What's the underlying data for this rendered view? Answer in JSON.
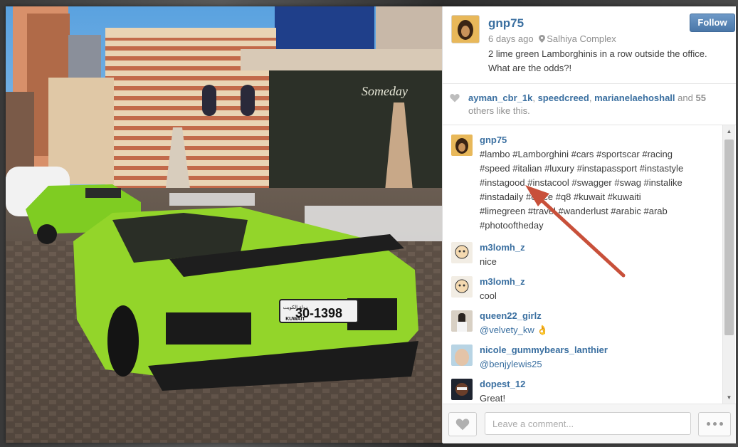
{
  "post": {
    "username": "gnp75",
    "follow_label": "Follow",
    "time_ago": "6 days ago",
    "location": "Salhiya Complex",
    "caption": "2 lime green Lamborghinis in a row outside the office. What are the odds?!",
    "photo": {
      "store_sign": "Someday",
      "plate_number": "30-1398",
      "plate_country": "KUWAIT",
      "plate_arabic": "دولة الكويت"
    }
  },
  "likes": {
    "users": [
      "ayman_cbr_1k",
      "speedcreed",
      "marianelaehoshall"
    ],
    "and_word": "and",
    "others_count": "55",
    "others_text": "others like this."
  },
  "comments": [
    {
      "user": "gnp75",
      "avatar_color": "#c48a2a",
      "lines": [
        "#lambo #Lamborghini #cars #sportscar #racing",
        "#speed #italian #luxury #instapassport #instastyle",
        "#instagood #instacool #swagger #swag #instalike",
        "#instadaily #office #q8 #kuwait #kuwaiti",
        "#limegreen #travel #wanderlust #arabic #arab",
        "#photooftheday"
      ]
    },
    {
      "user": "m3lomh_z",
      "avatar_color": "#e8e0d0",
      "text": "nice"
    },
    {
      "user": "m3lomh_z",
      "avatar_color": "#e8e0d0",
      "text": "cool"
    },
    {
      "user": "queen22_girlz",
      "avatar_color": "#6a5a4a",
      "text": "@velvety_kw 👌"
    },
    {
      "user": "nicole_gummybears_lanthier",
      "avatar_color": "#c9b8a8",
      "text": "@benjylewis25"
    },
    {
      "user": "dopest_12",
      "avatar_color": "#3a3a3a",
      "text": "Great!"
    }
  ],
  "footer": {
    "comment_placeholder": "Leave a comment..."
  },
  "icons": {
    "location": "map-pin-icon",
    "likes": "heart-icon",
    "like_button": "heart-icon",
    "more": "ellipsis-icon",
    "annotation": "red-arrow-icon"
  },
  "colors": {
    "link_blue": "#3a6fa0",
    "follow_button": "#4a77a8",
    "car_lime": "#8fd42a",
    "annotation_arrow": "#c8503a"
  }
}
